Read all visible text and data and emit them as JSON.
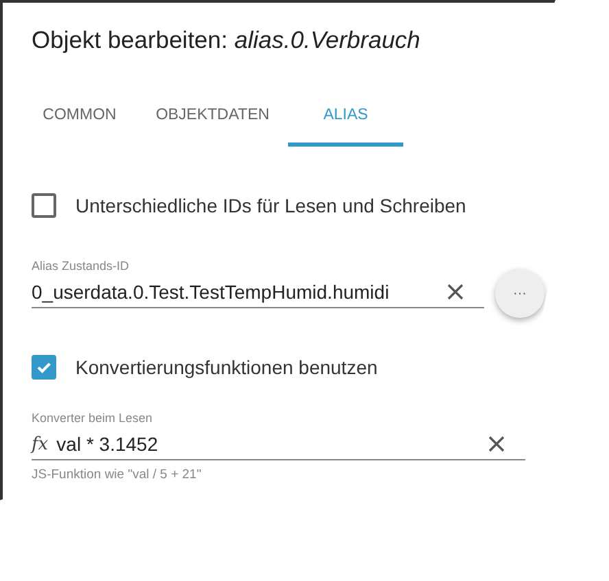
{
  "dialog": {
    "title_prefix": "Objekt bearbeiten: ",
    "title_object": "alias.0.Verbrauch"
  },
  "tabs": [
    {
      "label": "COMMON",
      "selected": false
    },
    {
      "label": "OBJEKTDATEN",
      "selected": false
    },
    {
      "label": "ALIAS",
      "selected": true
    }
  ],
  "separate_ids": {
    "label": "Unterschiedliche IDs für Lesen und Schreiben",
    "checked": false
  },
  "alias_id": {
    "label": "Alias Zustands-ID",
    "value": "0_userdata.0.Test.TestTempHumid.humidi",
    "more_button": "···"
  },
  "use_converters": {
    "label": "Konvertierungsfunktionen benutzen",
    "checked": true
  },
  "read_converter": {
    "label": "Konverter beim Lesen",
    "prefix": "fx",
    "value": "val * 3.1452",
    "helper": "JS-Funktion wie \"val / 5 + 21\""
  }
}
